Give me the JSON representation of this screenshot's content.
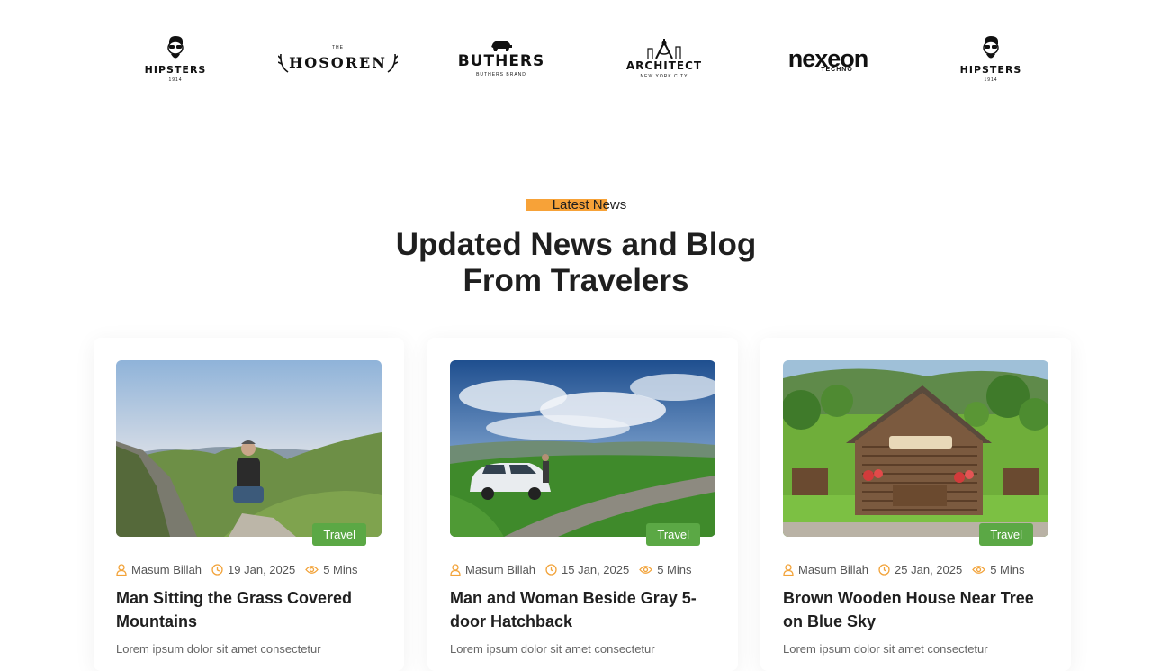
{
  "brands": [
    {
      "name": "HIPSTERS",
      "tagline": "1914",
      "icon": "hipster-face-icon"
    },
    {
      "name": "HOSOREN",
      "tagline": "THE",
      "icon": "antlers-icon"
    },
    {
      "name": "BUTHERS",
      "tagline": "BUTHERS BRAND",
      "icon": "pig-icon"
    },
    {
      "name": "ARCHITECT",
      "tagline": "NEW YORK CITY",
      "icon": "compass-icon"
    },
    {
      "name": "nexeon",
      "tagline": "TECHNO",
      "icon": "nexeon-x-icon"
    },
    {
      "name": "HIPSTERS",
      "tagline": "1914",
      "icon": "hipster-face-icon"
    }
  ],
  "section": {
    "eyebrow": "Latest News",
    "title_line1": "Updated News and Blog",
    "title_line2": "From Travelers"
  },
  "posts": [
    {
      "tag": "Travel",
      "author": "Masum Billah",
      "date": "19 Jan, 2025",
      "read_time": "5 Mins",
      "title": "Man Sitting the Grass Covered Mountains",
      "excerpt": "Lorem ipsum dolor sit amet consectetur"
    },
    {
      "tag": "Travel",
      "author": "Masum Billah",
      "date": "15 Jan, 2025",
      "read_time": "5 Mins",
      "title": "Man and Woman Beside Gray 5-door Hatchback",
      "excerpt": "Lorem ipsum dolor sit amet consectetur"
    },
    {
      "tag": "Travel",
      "author": "Masum Billah",
      "date": "25 Jan, 2025",
      "read_time": "5 Mins",
      "title": "Brown Wooden House Near Tree on Blue Sky",
      "excerpt": "Lorem ipsum dolor sit amet consectetur"
    }
  ],
  "colors": {
    "accent": "#f7a238",
    "tag_green": "#5ba845",
    "meta_icon": "#f2a33a",
    "text_dark": "#1f1f1f"
  }
}
